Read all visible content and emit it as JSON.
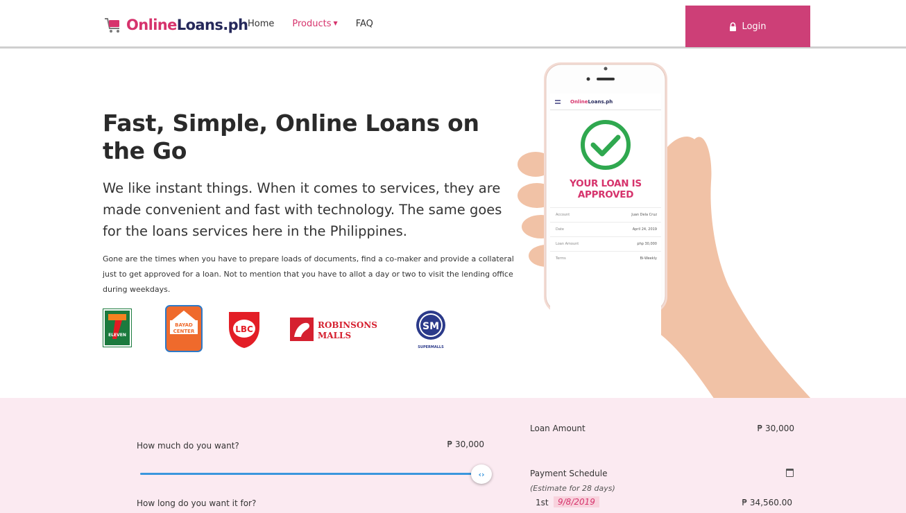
{
  "header": {
    "logo_part1": "Online",
    "logo_part2": "Loans.ph",
    "nav": [
      {
        "label": "Home"
      },
      {
        "label": "Products"
      },
      {
        "label": "FAQ"
      }
    ],
    "login_label": "Login"
  },
  "hero": {
    "title": "Fast, Simple, Online Loans on the Go",
    "subtitle": "We like instant things. When it comes to services, they are made convenient and fast with technology. The same goes for the loans services here in the Philippines.",
    "body": "Gone are the times when you have to prepare loads of documents, find a co-maker and provide a collateral just to get approved for a loan. Not to mention that you have to allot a day or two to visit the lending office during weekdays."
  },
  "partners": {
    "seven_eleven": "ELEVEN",
    "bayad_center_line1": "BAYAD",
    "bayad_center_line2": "CENTER",
    "lbc": "LBC",
    "robinsons_line1": "ROBINSONS",
    "robinsons_line2": "MALLS",
    "sm": "SM",
    "sm_caption": "SUPERMALLS"
  },
  "phone": {
    "logo_part1": "Online",
    "logo_part2": "Loans.ph",
    "approved_line1": "YOUR LOAN IS",
    "approved_line2": "APPROVED",
    "rows": [
      {
        "key": "Account",
        "value": "Juan Dela Cruz"
      },
      {
        "key": "Date",
        "value": "April 24, 2019"
      },
      {
        "key": "Loan Amount",
        "value": "php 30,000"
      },
      {
        "key": "Terms",
        "value": "Bi-Weekly"
      }
    ]
  },
  "calculator": {
    "question_amount": "How much do you want?",
    "amount_value": "₱ 30,000",
    "slider_fraction": 1.0,
    "question_duration": "How long do you want it for?",
    "summary_amount_label": "Loan Amount",
    "summary_amount_value": "₱ 30,000",
    "schedule_label": "Payment Schedule",
    "schedule_estimate": "(Estimate for 28 days)",
    "installment_no": "1st",
    "installment_date": "9/8/2019",
    "installment_amount": "₱ 34,560.00"
  },
  "colors": {
    "brand_pink": "#cd3f77",
    "brand_navy": "#25285a",
    "calc_bg": "#fbeaf1",
    "slider_blue": "#3a96dd"
  },
  "icons": [
    "cart-logo-icon",
    "caret-down-icon",
    "lock-icon",
    "check-circle-icon",
    "calendar-icon",
    "slider-arrows-icon"
  ]
}
